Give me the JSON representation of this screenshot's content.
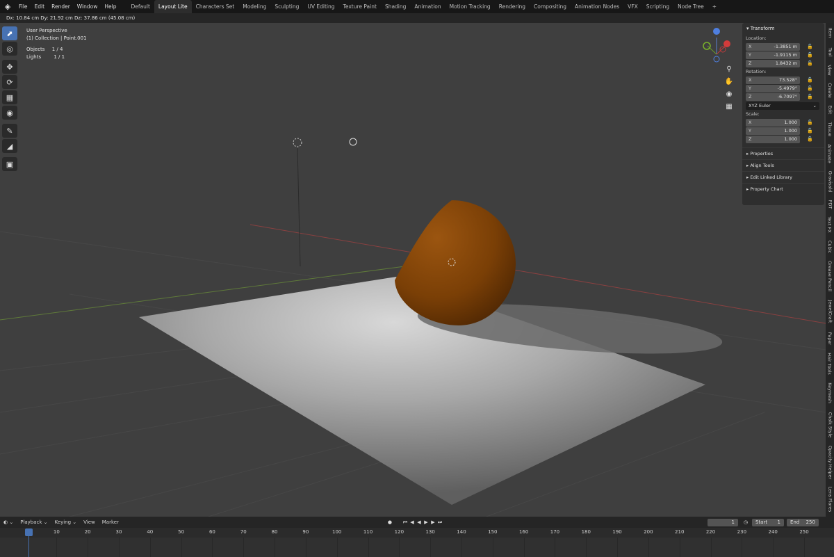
{
  "menu": {
    "items": [
      "File",
      "Edit",
      "Render",
      "Window",
      "Help"
    ]
  },
  "workspaces": {
    "active": "Layout Lite",
    "tabs": [
      "Default",
      "Layout Lite",
      "Characters Set",
      "Modeling",
      "Sculpting",
      "UV Editing",
      "Texture Paint",
      "Shading",
      "Animation",
      "Motion Tracking",
      "Rendering",
      "Compositing",
      "Animation Nodes",
      "VFX",
      "Scripting",
      "Node Tree"
    ],
    "add_symbol": "+"
  },
  "header_info": {
    "text": "Dx: 10.84 cm   Dy: 21.92 cm   Dz: 37.86 cm (45.08 cm)"
  },
  "viewport": {
    "title": "User Perspective",
    "collection": "(1) Collection | Point.001",
    "objects_label": "Objects",
    "objects_value": "1 / 4",
    "lights_label": "Lights",
    "lights_value": "1 / 1",
    "colors": {
      "sphere": "#8a4a08",
      "floor": "#bdbdbd",
      "background": "#3f3f3f"
    }
  },
  "toolbar": {
    "tools": [
      "select-box",
      "cursor",
      "move",
      "rotate",
      "scale",
      "transform",
      "annotate",
      "measure",
      "add-cube"
    ],
    "active": "select-box"
  },
  "gizmo": {
    "axes": [
      "X",
      "Y",
      "Z"
    ],
    "nav_buttons": [
      "zoom-icon",
      "hand-icon",
      "camera-icon",
      "grid-icon"
    ]
  },
  "npanel": {
    "transform_label": "Transform",
    "location_label": "Location:",
    "location": [
      {
        "axis": "X",
        "value": "-1.3851 m"
      },
      {
        "axis": "Y",
        "value": "-1.9115 m"
      },
      {
        "axis": "Z",
        "value": "1.8432 m"
      }
    ],
    "rotation_label": "Rotation:",
    "rotation": [
      {
        "axis": "X",
        "value": "73.528°"
      },
      {
        "axis": "Y",
        "value": "-5.4979°"
      },
      {
        "axis": "Z",
        "value": "-6.7097°"
      }
    ],
    "rotation_mode": "XYZ Euler",
    "scale_label": "Scale:",
    "scale": [
      {
        "axis": "X",
        "value": "1.000"
      },
      {
        "axis": "Y",
        "value": "1.000"
      },
      {
        "axis": "Z",
        "value": "1.000"
      }
    ],
    "sections": [
      "Properties",
      "Align Tools",
      "Edit Linked Library",
      "Property Chart"
    ]
  },
  "sidetabs": [
    "Item",
    "Tool",
    "View",
    "Create",
    "Edit",
    "Tissue",
    "Animate",
    "Gravisald",
    "PDT",
    "Text FX",
    "Cubic",
    "Grease Pencil",
    "JewelCraft",
    "Paper",
    "Hair Tools",
    "Keymesh",
    "Chalk Style",
    "Opacity Helper",
    "Lens Flares"
  ],
  "timeline": {
    "menus": [
      "Playback",
      "Keying",
      "View",
      "Marker"
    ],
    "current_frame": "1",
    "start_label": "Start",
    "start_value": "1",
    "end_label": "End",
    "end_value": "250",
    "ruler_ticks": [
      "1",
      "10",
      "20",
      "30",
      "40",
      "50",
      "60",
      "70",
      "80",
      "90",
      "100",
      "110",
      "120",
      "130",
      "140",
      "150",
      "160",
      "170",
      "180",
      "190",
      "200",
      "210",
      "220",
      "230",
      "240",
      "250"
    ]
  }
}
